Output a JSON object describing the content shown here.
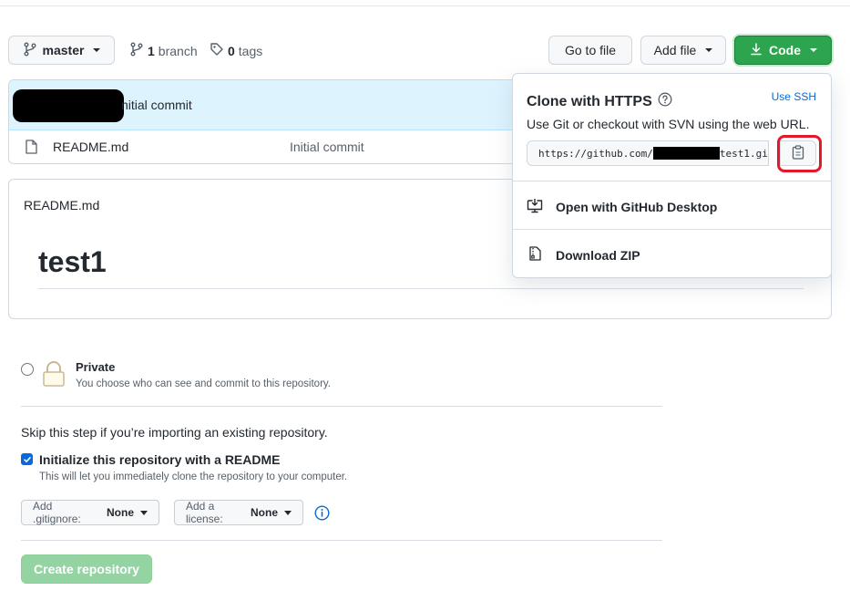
{
  "branch_bar": {
    "branch_name": "master",
    "branch_count": "1",
    "branch_word": "branch",
    "tag_count": "0",
    "tag_word": "tags",
    "go_to_file": "Go to file",
    "add_file": "Add file",
    "code": "Code"
  },
  "commit_header": {
    "message_partial": "nitial commit"
  },
  "files": [
    {
      "name": "README.md",
      "message": "Initial commit"
    }
  ],
  "readme": {
    "filename": "README.md",
    "heading": "test1"
  },
  "clone_popup": {
    "title": "Clone with HTTPS",
    "use_ssh": "Use SSH",
    "description": "Use Git or checkout with SVN using the web URL.",
    "url_start": "https://github.com/",
    "url_end": "test1.gi",
    "open_desktop": "Open with GitHub Desktop",
    "download_zip": "Download ZIP"
  },
  "new_repo_form": {
    "private_label": "Private",
    "private_desc": "You choose who can see and commit to this repository.",
    "skip_text": "Skip this step if you’re importing an existing repository.",
    "init_readme_label": "Initialize this repository with a README",
    "init_readme_desc": "This will let you immediately clone the repository to your computer.",
    "init_readme_checked": true,
    "gitignore_prefix": "Add .gitignore:",
    "gitignore_value": "None",
    "license_prefix": "Add a license:",
    "license_value": "None",
    "create_button": "Create repository"
  },
  "colors": {
    "accent_green": "#2da44e",
    "create_disabled_green": "#94d3a2",
    "link_blue": "#0969da",
    "highlight_red": "#e5172b"
  }
}
